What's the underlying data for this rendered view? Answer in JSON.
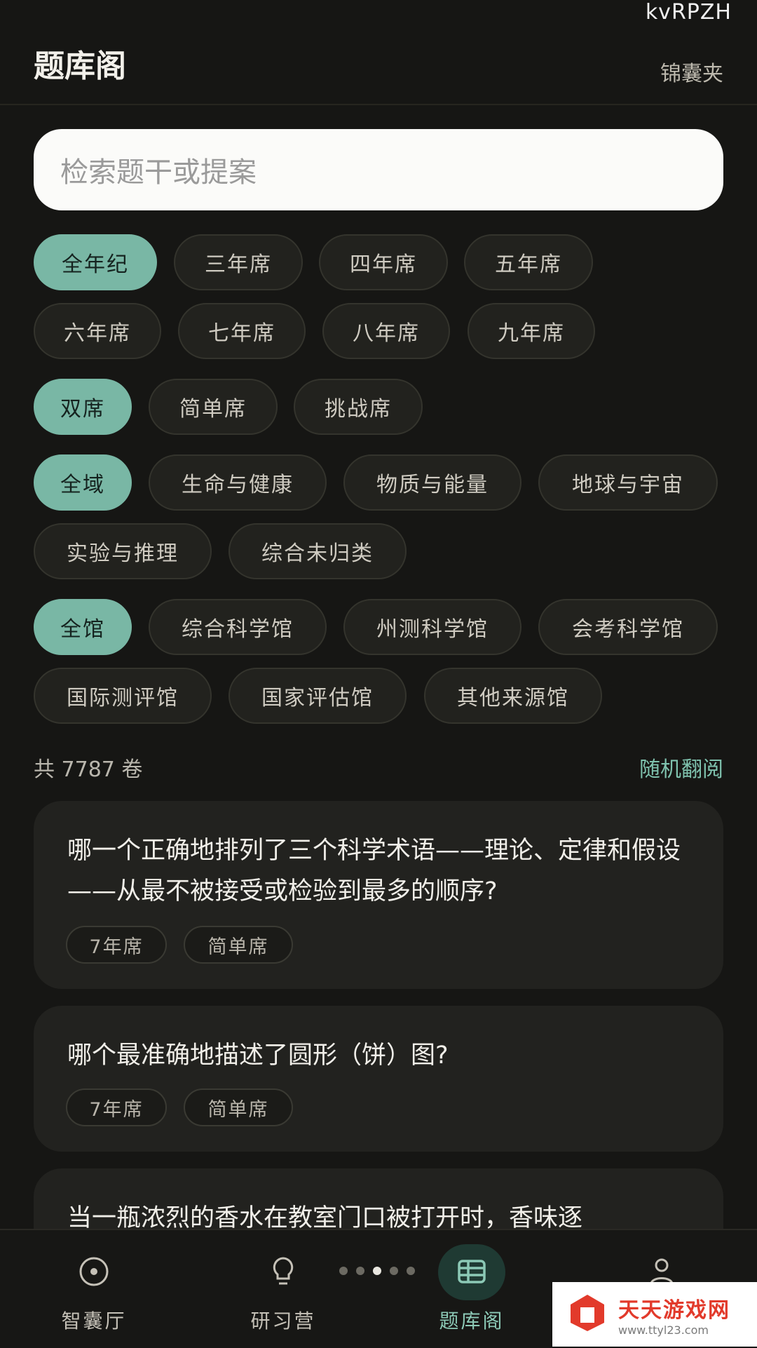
{
  "status": {
    "text": "kvRPZH"
  },
  "header": {
    "title": "题库阁",
    "action": "锦囊夹"
  },
  "search": {
    "placeholder": "检索题干或提案"
  },
  "filters": {
    "grades": [
      "全年纪",
      "三年席",
      "四年席",
      "五年席",
      "六年席",
      "七年席",
      "八年席",
      "九年席"
    ],
    "difficulty": [
      "双席",
      "简单席",
      "挑战席"
    ],
    "domains": [
      "全域",
      "生命与健康",
      "物质与能量",
      "地球与宇宙",
      "实验与推理",
      "综合未归类"
    ],
    "sources": [
      "全馆",
      "综合科学馆",
      "州测科学馆",
      "会考科学馆",
      "国际测评馆",
      "国家评估馆",
      "其他来源馆"
    ]
  },
  "summary": {
    "count": "共 7787 卷",
    "random": "随机翻阅"
  },
  "questions": [
    {
      "text": "哪一个正确地排列了三个科学术语——理论、定律和假设——从最不被接受或检验到最多的顺序?",
      "tags": [
        "7年席",
        "简单席"
      ]
    },
    {
      "text": "哪个最准确地描述了圆形（饼）图?",
      "tags": [
        "7年席",
        "简单席"
      ]
    },
    {
      "text": "当一瓶浓烈的香水在教室门口被打开时，香味逐"
    }
  ],
  "nav": {
    "items": [
      {
        "label": "智囊厅",
        "icon": "compass-icon"
      },
      {
        "label": "研习营",
        "icon": "lightbulb-icon"
      },
      {
        "label": "题库阁",
        "icon": "table-icon"
      },
      {
        "label": "",
        "icon": "user-icon"
      }
    ],
    "active_index": 2
  },
  "watermark": {
    "main": "天天游戏网",
    "sub": "www.ttyl23.com"
  },
  "colors": {
    "accent": "#79b7a5",
    "background": "#161614",
    "card": "#22221f"
  }
}
